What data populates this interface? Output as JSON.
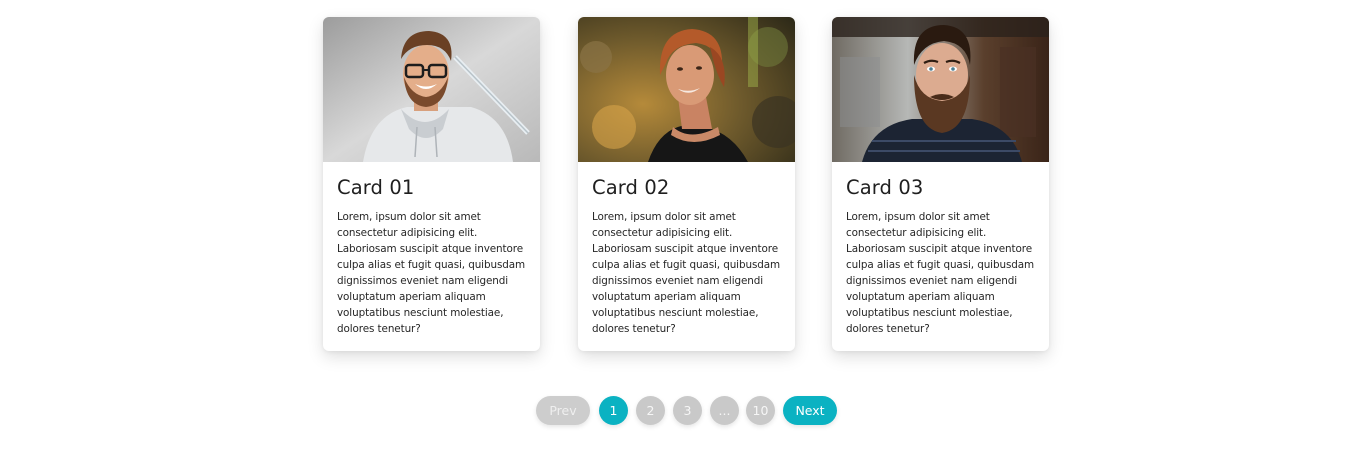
{
  "cards": [
    {
      "title": "Card 01",
      "text": "Lorem, ipsum dolor sit amet consectetur adipisicing elit. Laboriosam suscipit atque inventore culpa alias et fugit quasi, quibusdam dignissimos eveniet nam eligendi voluptatum aperiam aliquam voluptatibus nesciunt molestiae, dolores tenetur?"
    },
    {
      "title": "Card 02",
      "text": "Lorem, ipsum dolor sit amet consectetur adipisicing elit. Laboriosam suscipit atque inventore culpa alias et fugit quasi, quibusdam dignissimos eveniet nam eligendi voluptatum aperiam aliquam voluptatibus nesciunt molestiae, dolores tenetur?"
    },
    {
      "title": "Card 03",
      "text": "Lorem, ipsum dolor sit amet consectetur adipisicing elit. Laboriosam suscipit atque inventore culpa alias et fugit quasi, quibusdam dignissimos eveniet nam eligendi voluptatum aperiam aliquam voluptatibus nesciunt molestiae, dolores tenetur?"
    }
  ],
  "pagination": {
    "prev": "Prev",
    "pages": [
      "1",
      "2",
      "3",
      "...",
      "10"
    ],
    "active_page": "1",
    "next": "Next"
  },
  "colors": {
    "accent": "#0bb2c2",
    "inactive": "#c9c9c9"
  }
}
